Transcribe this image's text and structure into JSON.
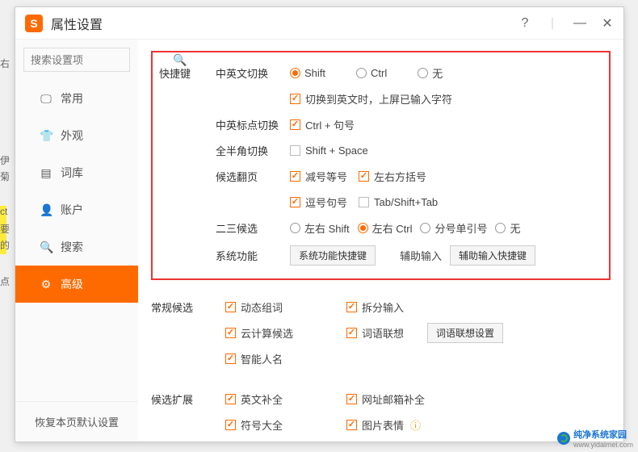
{
  "window": {
    "title": "属性设置",
    "help": "?",
    "minimize": "—",
    "close": "✕"
  },
  "sidebar": {
    "search_placeholder": "搜索设置项",
    "items": [
      {
        "icon": "▢",
        "label": "常用"
      },
      {
        "icon": "⎋",
        "label": "外观"
      },
      {
        "icon": "▤",
        "label": "词库"
      },
      {
        "icon": "◉",
        "label": "账户"
      },
      {
        "icon": "⚲",
        "label": "搜索"
      },
      {
        "icon": "⚙",
        "label": "高级"
      }
    ],
    "restore": "恢复本页默认设置"
  },
  "sections": {
    "hotkey": {
      "title": "快捷键",
      "cn_en_switch": {
        "label": "中英文切换",
        "options": [
          "Shift",
          "Ctrl",
          "无"
        ],
        "selected": 0,
        "commit_label": "切换到英文时，上屏已输入字符"
      },
      "punct_switch": {
        "label": "中英标点切换",
        "option": "Ctrl + 句号"
      },
      "fullhalf": {
        "label": "全半角切换",
        "option": "Shift + Space"
      },
      "page": {
        "label": "候选翻页",
        "opts": [
          "减号等号",
          "左右方括号",
          "逗号句号",
          "Tab/Shift+Tab"
        ]
      },
      "cand23": {
        "label": "二三候选",
        "opts": [
          "左右 Shift",
          "左右 Ctrl",
          "分号单引号",
          "无"
        ],
        "selected": 1
      },
      "sysfunc": {
        "label": "系统功能",
        "btn1": "系统功能快捷键",
        "aux_label": "辅助输入",
        "btn2": "辅助输入快捷键"
      }
    },
    "normal": {
      "title": "常规候选",
      "dynamic": "动态组词",
      "split": "拆分输入",
      "cloud": "云计算候选",
      "assoc": "词语联想",
      "assoc_btn": "词语联想设置",
      "smart_name": "智能人名"
    },
    "expand": {
      "title": "候选扩展",
      "english": "英文补全",
      "url": "网址邮箱补全",
      "symbols": "符号大全",
      "emoji": "图片表情"
    }
  },
  "watermark": {
    "brand": "纯净系统家园",
    "url": "www.yidaimei.com"
  }
}
